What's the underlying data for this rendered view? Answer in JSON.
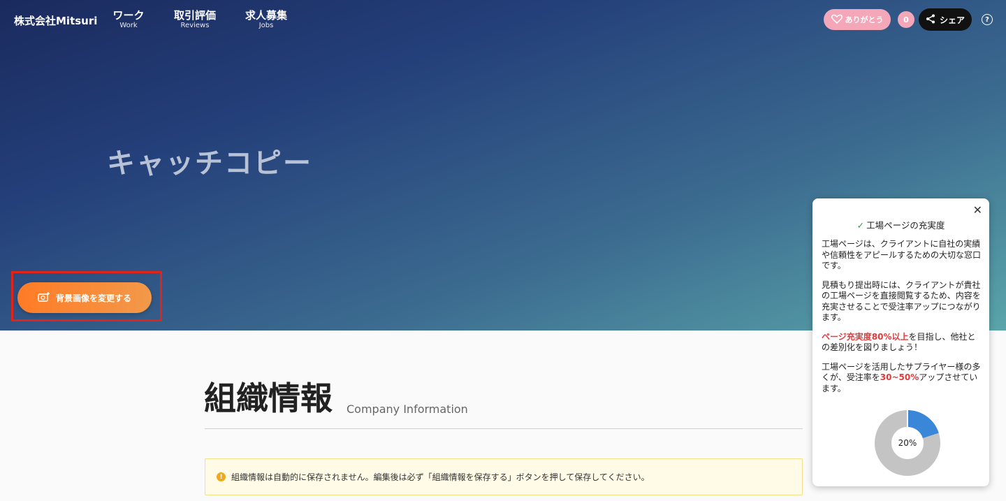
{
  "header": {
    "brand": "株式会社Mitsuri",
    "nav": [
      {
        "jp": "ワーク",
        "en": "Work"
      },
      {
        "jp": "取引評価",
        "en": "Reviews"
      },
      {
        "jp": "求人募集",
        "en": "Jobs"
      }
    ],
    "thanks_label": "ありがとう",
    "thanks_count": "0",
    "share_label": "シェア",
    "help_symbol": "?"
  },
  "hero": {
    "catchcopy": "キャッチコピー",
    "bg_button_label": "背景画像を変更する"
  },
  "section": {
    "title": "組織情報",
    "subtitle": "Company Information",
    "notice": "組織情報は自動的に保存されません。編集後は必ず「組織情報を保存する」ボタンを押して保存してください。"
  },
  "panel": {
    "title": "工場ページの充実度",
    "p1": "工場ページは、クライアントに自社の実績や信頼性をアピールするための大切な窓口です。",
    "p2": "見積もり提出時には、クライアントが貴社の工場ページを直接閲覧するため、内容を充実させることで受注率アップにつながります。",
    "p3_highlight": "ページ充実度80%以上",
    "p3_rest": "を目指し、他社との差別化を図りましょう！",
    "p4_pre": "工場ページを活用したサプライヤー様の多くが、受注率を",
    "p4_highlight": "30~50%",
    "p4_post": "アップさせています。",
    "progress_label": "20%",
    "progress_value": 0.2
  },
  "colors": {
    "accent_orange": "#ff7b25",
    "progress_blue": "#3a86d8",
    "progress_track": "#c4c4c4",
    "highlight_red": "#e23b3b",
    "thanks_pink": "#f3a7b8"
  }
}
